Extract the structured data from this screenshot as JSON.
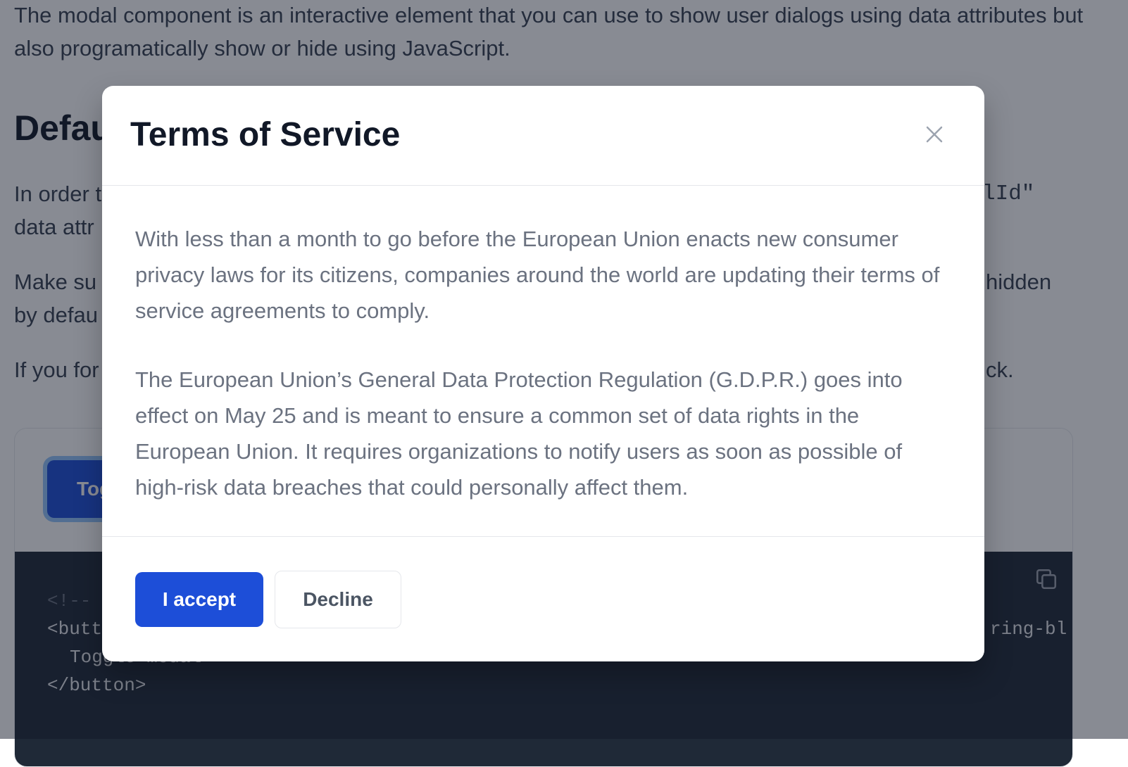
{
  "background_page": {
    "intro": "The modal component is an interactive element that you can use to show user dialogs using data attributes but also programatically show or hide using JavaScript.",
    "heading": "Defau",
    "para1_start": "In order t",
    "para1_line2": "data attr",
    "para1_code_fragment": "lId\"",
    "para2_start": "Make su",
    "para2_line2": "by defau",
    "para2_end_fragment": "hidden",
    "para3_start": "If you for",
    "para3_end_fragment": "ck.",
    "toggle_button_label": "Tog",
    "code_lines": {
      "comment": "<!--",
      "button_open": "<butt",
      "button_text": "Toggle modal",
      "button_close": "</button>",
      "right_fragment": "ring-bl"
    }
  },
  "modal": {
    "title": "Terms of Service",
    "body": [
      "With less than a month to go before the European Union enacts new consumer privacy laws for its citizens, companies around the world are updating their terms of service agreements to comply.",
      "The European Union’s General Data Protection Regulation (G.D.P.R.) goes into effect on May 25 and is meant to ensure a common set of data rights in the European Union. It requires organizations to notify users as soon as possible of high-risk data breaches that could personally affect them."
    ],
    "accept_label": "I accept",
    "decline_label": "Decline"
  },
  "icons": {
    "close": "close-icon",
    "copy": "copy-icon"
  },
  "colors": {
    "primary": "#1d4ed8",
    "overlay": "rgba(17,24,39,0.5)",
    "code_bg": "#1f2937"
  }
}
